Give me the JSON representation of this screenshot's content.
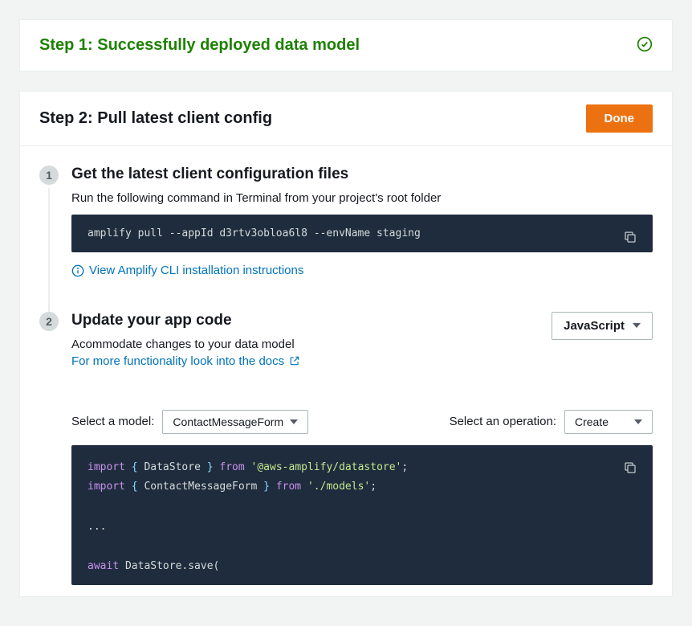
{
  "step1": {
    "title": "Step 1: Successfully deployed data model"
  },
  "step2": {
    "title": "Step 2: Pull latest client config",
    "done_button": "Done",
    "sub1": {
      "num": "1",
      "title": "Get the latest client configuration files",
      "desc": "Run the following command in Terminal from your project's root folder",
      "cmd": "amplify pull --appId d3rtv3obloa6l8 --envName staging",
      "cli_link": "View Amplify CLI installation instructions"
    },
    "sub2": {
      "num": "2",
      "title": "Update your app code",
      "desc": "Acommodate changes to your data model",
      "docs_link": "For more functionality look into the docs",
      "lang_select": "JavaScript",
      "model_label": "Select a model:",
      "model_value": "ContactMessageForm",
      "op_label": "Select an operation:",
      "op_value": "Create",
      "code_line1_a": "import",
      "code_line1_b": " { ",
      "code_line1_c": "DataStore",
      "code_line1_d": " } ",
      "code_line1_e": "from",
      "code_line1_f": "'@aws-amplify/datastore'",
      "code_line1_g": ";",
      "code_line2_a": "import",
      "code_line2_b": " { ",
      "code_line2_c": "ContactMessageForm",
      "code_line2_d": " } ",
      "code_line2_e": "from",
      "code_line2_f": "'./models'",
      "code_line2_g": ";",
      "code_dots": "...",
      "code_line4_a": "await",
      "code_line4_b": " DataStore.save("
    }
  }
}
